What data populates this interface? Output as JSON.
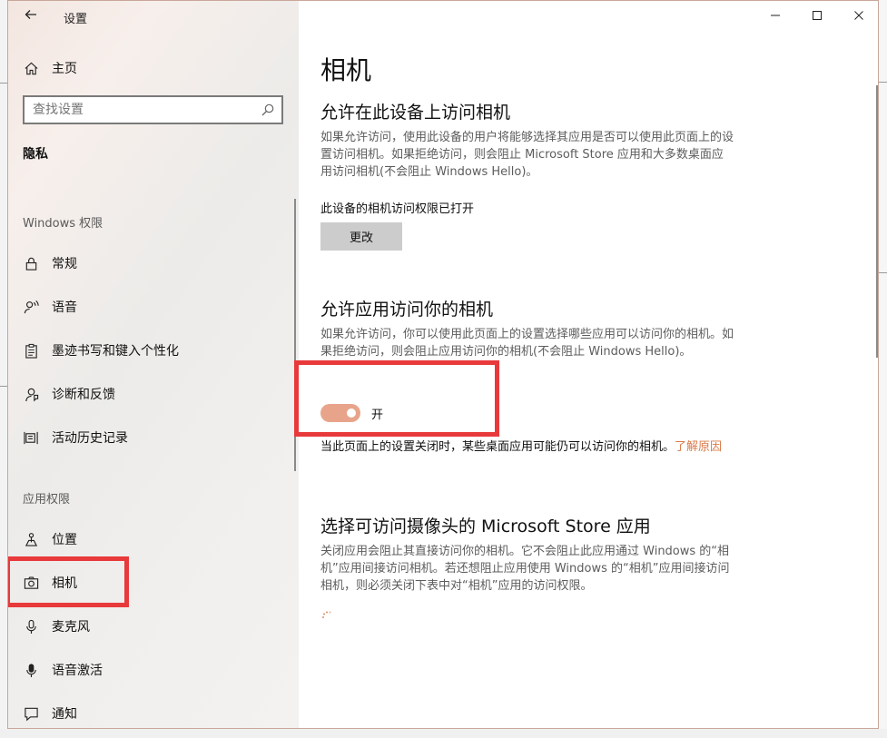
{
  "window": {
    "title": "设置",
    "controls": {
      "minimize": "—",
      "maximize": "☐",
      "close": "✕"
    }
  },
  "sidebar": {
    "home": "主页",
    "search_placeholder": "查找设置",
    "section": "隐私",
    "windows_group": "Windows 权限",
    "windows_items": [
      {
        "label": "常规",
        "icon": "lock-icon"
      },
      {
        "label": "语音",
        "icon": "speech-icon"
      },
      {
        "label": "墨迹书写和键入个性化",
        "icon": "clipboard-icon"
      },
      {
        "label": "诊断和反馈",
        "icon": "feedback-icon"
      },
      {
        "label": "活动历史记录",
        "icon": "history-icon"
      }
    ],
    "app_group": "应用权限",
    "app_items": [
      {
        "label": "位置",
        "icon": "location-icon"
      },
      {
        "label": "相机",
        "icon": "camera-icon"
      },
      {
        "label": "麦克风",
        "icon": "microphone-icon"
      },
      {
        "label": "语音激活",
        "icon": "voice-activation-icon"
      },
      {
        "label": "通知",
        "icon": "notification-icon"
      }
    ]
  },
  "main": {
    "title": "相机",
    "device": {
      "heading": "允许在此设备上访问相机",
      "description": "如果允许访问，使用此设备的用户将能够选择其应用是否可以使用此页面上的设置访问相机。如果拒绝访问，则会阻止 Microsoft Store 应用和大多数桌面应用访问相机(不会阻止 Windows Hello)。",
      "status": "此设备的相机访问权限已打开",
      "change_button": "更改"
    },
    "apps": {
      "heading": "允许应用访问你的相机",
      "description": "如果允许访问，你可以使用此页面上的设置选择哪些应用可以访问你的相机。如果拒绝访问，则会阻止应用访问你的相机(不会阻止 Windows Hello)。",
      "toggle_state": "开",
      "toggle_on": true,
      "note": "当此页面上的设置关闭时，某些桌面应用可能仍可以访问你的相机。",
      "learn_more": "了解原因"
    },
    "store": {
      "heading": "选择可访问摄像头的 Microsoft Store 应用",
      "description": "关闭应用会阻止其直接访问你的相机。它不会阻止此应用通过 Windows 的“相机”应用间接访问相机。若还想阻止应用使用 Windows 的“相机”应用间接访问相机，则必须关闭下表中对“相机”应用的访问权限。"
    }
  },
  "colors": {
    "accent": "#e8a48a",
    "link": "#d97b4a",
    "highlight": "#e8393b"
  }
}
